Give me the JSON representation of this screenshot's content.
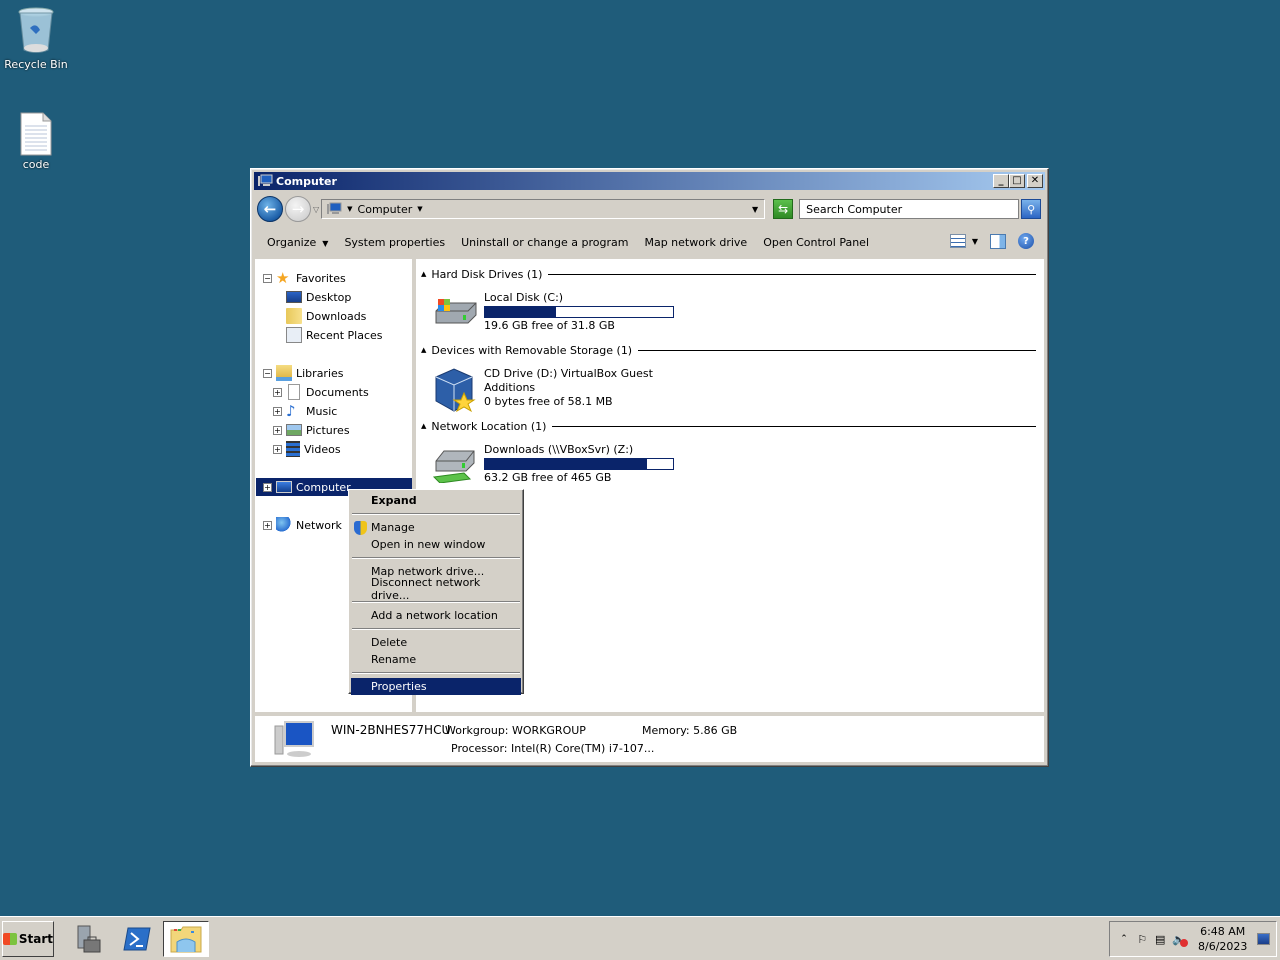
{
  "desktop": {
    "icons": [
      {
        "label": "Recycle Bin",
        "icon": "recycle-bin-icon"
      },
      {
        "label": "code",
        "icon": "text-file-icon"
      }
    ]
  },
  "window": {
    "title": "Computer",
    "controls": {
      "minimize": "_",
      "maximize": "□",
      "close": "✕"
    }
  },
  "navbar": {
    "address_crumbs": [
      "Computer"
    ],
    "search_placeholder": "Search Computer"
  },
  "toolbar": {
    "commands": [
      {
        "label": "Organize",
        "has_dropdown": true
      },
      {
        "label": "System properties"
      },
      {
        "label": "Uninstall or change a program"
      },
      {
        "label": "Map network drive"
      },
      {
        "label": "Open Control Panel"
      }
    ],
    "help": "?"
  },
  "navpane": {
    "items": [
      {
        "label": "Favorites",
        "expander": "−",
        "icon": "star-icon",
        "level": 0
      },
      {
        "label": "Desktop",
        "icon": "desktop-icon",
        "level": 1
      },
      {
        "label": "Downloads",
        "icon": "downloads-folder-icon",
        "level": 1
      },
      {
        "label": "Recent Places",
        "icon": "recent-places-icon",
        "level": 1
      },
      {
        "label": "Libraries",
        "expander": "−",
        "icon": "libraries-icon",
        "level": 0
      },
      {
        "label": "Documents",
        "expander": "+",
        "icon": "documents-icon",
        "level": 1
      },
      {
        "label": "Music",
        "expander": "+",
        "icon": "music-icon",
        "level": 1
      },
      {
        "label": "Pictures",
        "expander": "+",
        "icon": "pictures-icon",
        "level": 1
      },
      {
        "label": "Videos",
        "expander": "+",
        "icon": "videos-icon",
        "level": 1
      },
      {
        "label": "Computer",
        "expander": "+",
        "icon": "computer-icon",
        "level": 0,
        "selected": true
      },
      {
        "label": "Network",
        "expander": "+",
        "icon": "network-icon",
        "level": 0
      }
    ]
  },
  "content": {
    "groups": [
      {
        "header": "Hard Disk Drives (1)",
        "drives": [
          {
            "name": "Local Disk (C:)",
            "free_text": "19.6 GB free of 31.8 GB",
            "used_fraction": 0.38,
            "icon": "hard-disk-icon"
          }
        ]
      },
      {
        "header": "Devices with Removable Storage (1)",
        "drives": [
          {
            "name": "CD Drive (D:) VirtualBox Guest",
            "name_line2": "Additions",
            "free_text": "0 bytes free of 58.1 MB",
            "icon": "virtualbox-cd-icon"
          }
        ]
      },
      {
        "header": "Network Location (1)",
        "drives": [
          {
            "name": "Downloads (\\\\VBoxSvr) (Z:)",
            "free_text": "63.2 GB free of 465 GB",
            "used_fraction": 0.86,
            "icon": "network-drive-icon"
          }
        ]
      }
    ]
  },
  "details": {
    "computer_name": "WIN-2BNHES77HCU",
    "workgroup_label": "Workgroup:",
    "workgroup": "WORKGROUP",
    "memory_label": "Memory:",
    "memory": "5.86 GB",
    "processor_label": "Processor:",
    "processor": "Intel(R) Core(TM) i7-107..."
  },
  "context_menu": {
    "items": [
      {
        "label": "Expand",
        "bold": true
      },
      {
        "sep": true
      },
      {
        "label": "Manage",
        "icon": "uac-shield-icon"
      },
      {
        "label": "Open in new window"
      },
      {
        "sep": true
      },
      {
        "label": "Map network drive..."
      },
      {
        "label": "Disconnect network drive..."
      },
      {
        "sep": true
      },
      {
        "label": "Add a network location"
      },
      {
        "sep": true
      },
      {
        "label": "Delete"
      },
      {
        "label": "Rename"
      },
      {
        "sep": true
      },
      {
        "label": "Properties",
        "highlighted": true
      }
    ]
  },
  "taskbar": {
    "start_label": "Start",
    "apps": [
      {
        "name": "server-manager"
      },
      {
        "name": "powershell"
      },
      {
        "name": "windows-explorer",
        "active": true
      }
    ],
    "tray": {
      "time": "6:48 AM",
      "date": "8/6/2023"
    }
  }
}
